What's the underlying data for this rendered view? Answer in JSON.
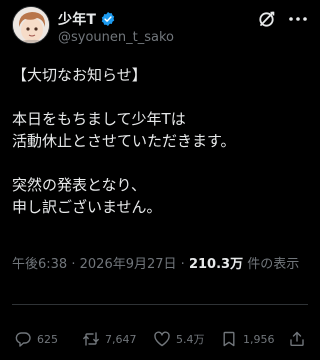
{
  "author": {
    "display_name": "少年T",
    "handle": "@syounen_t_sako",
    "avatar_icon": "avatar-illustration",
    "verified_color": "#1d9bf0"
  },
  "post": {
    "lines": [
      "【大切なお知らせ】",
      "",
      "本日をもちまして少年Tは",
      "活動休止とさせていただきます。",
      "",
      "突然の発表となり、",
      "申し訳ございません。"
    ],
    "time": "午後6:38",
    "separator": "·",
    "date": "2026年9月27日",
    "views_count": "210.3万",
    "views_label": "件の表示"
  },
  "actions": {
    "reply_count": "625",
    "retweet_count": "7,647",
    "like_count": "5.4万",
    "views_count": "1,956"
  },
  "colors": {
    "background": "#000000",
    "text": "#e7e9ea",
    "secondary": "#71767b",
    "divider": "#2f3336"
  }
}
